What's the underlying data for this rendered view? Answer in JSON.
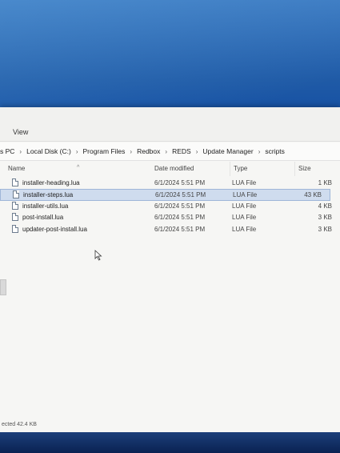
{
  "menu": {
    "view": "View"
  },
  "breadcrumb": [
    "s PC",
    "Local Disk (C:)",
    "Program Files",
    "Redbox",
    "REDS",
    "Update Manager",
    "scripts"
  ],
  "columns": {
    "name": "Name",
    "date": "Date modified",
    "type": "Type",
    "size": "Size"
  },
  "files": [
    {
      "name": "installer-heading.lua",
      "date": "6/1/2024 5:51 PM",
      "type": "LUA File",
      "size": "1 KB"
    },
    {
      "name": "installer-steps.lua",
      "date": "6/1/2024 5:51 PM",
      "type": "LUA File",
      "size": "43 KB"
    },
    {
      "name": "installer-utils.lua",
      "date": "6/1/2024 5:51 PM",
      "type": "LUA File",
      "size": "4 KB"
    },
    {
      "name": "post-install.lua",
      "date": "6/1/2024 5:51 PM",
      "type": "LUA File",
      "size": "3 KB"
    },
    {
      "name": "updater-post-install.lua",
      "date": "6/1/2024 5:51 PM",
      "type": "LUA File",
      "size": "3 KB"
    }
  ],
  "status": {
    "selected": "ected 42.4 KB"
  }
}
